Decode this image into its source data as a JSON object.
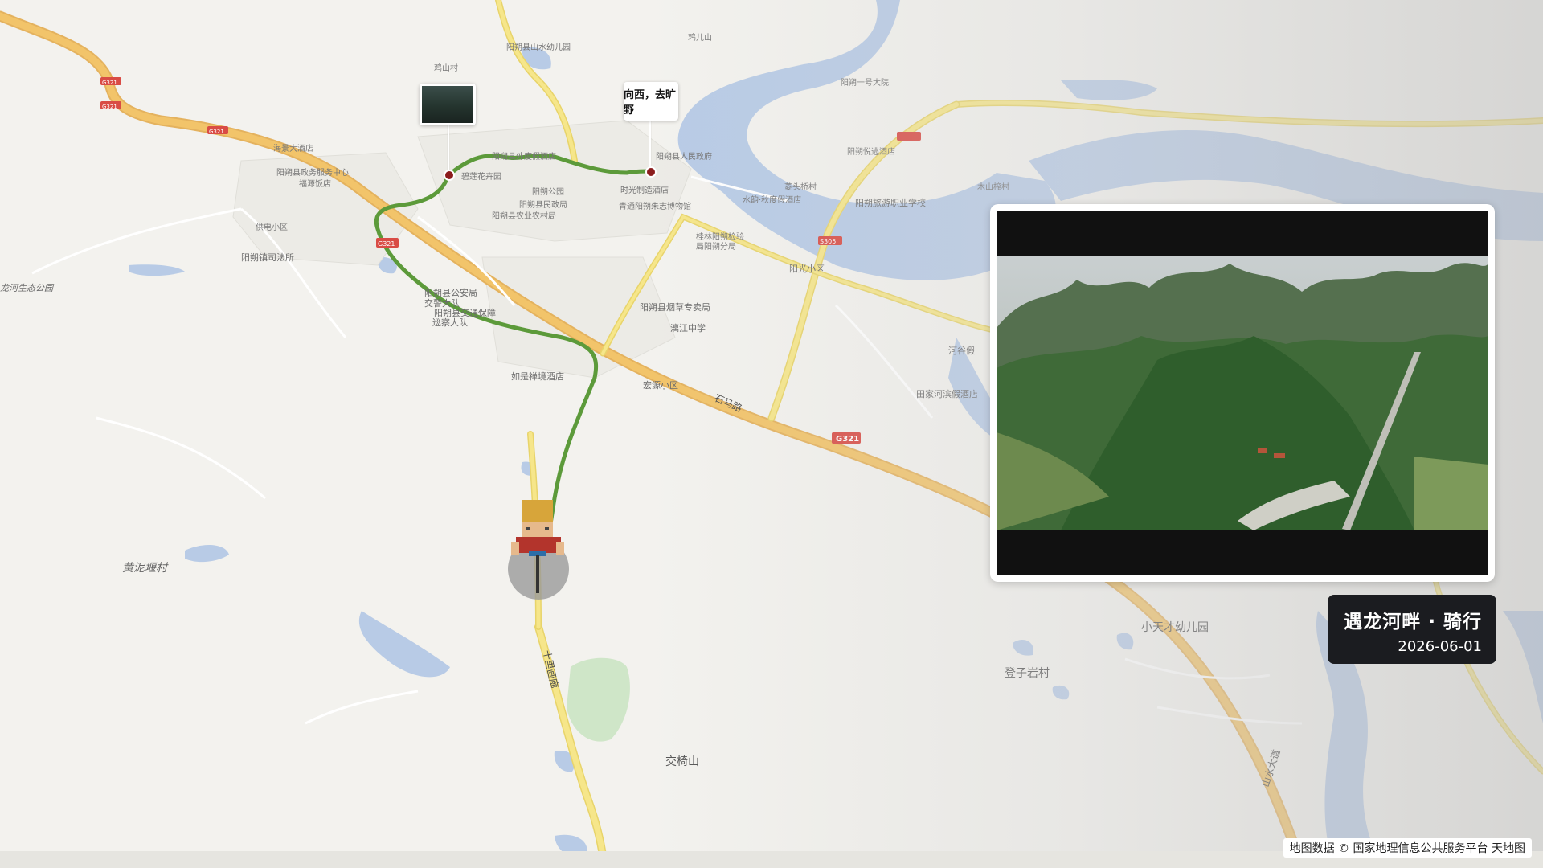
{
  "map": {
    "places": {
      "village1": "黄泥堰村",
      "mountain": "交椅山",
      "village2": "登子岩村",
      "kindergarten": "小天才幼儿园",
      "park": "龙河生态公园",
      "school1": "漓江中学",
      "hotel1": "如是禅境酒店",
      "resid1": "宏源小区",
      "resid2": "阳光小区",
      "hotel2": "田家河滨假酒店",
      "hotel3": "河谷假",
      "vschool": "阳朔旅游职业学校",
      "police": "阳朔县公安局",
      "police2": "交警大队",
      "police3": "阳朔县交通保障",
      "police4": "巡察大队",
      "court": "阳朔镇司法所",
      "tobacco": "阳朔县烟草专卖局",
      "gov": "阳朔县人民政府",
      "gov2": "阳朔县民政局",
      "gov3": "阳朔县农业农村局",
      "park2": "阳朔公园",
      "park3": "碧莲花卉园",
      "hotel4": "时光制造酒店",
      "museum": "青通阳朔朱志博物馆",
      "bank": "桂林阳朔检验",
      "bank2": "局阳朔分局",
      "service": "阳朔县政务服务中心",
      "hotel5": "海景大酒店",
      "hotel6": "福源饭店",
      "resid3": "供电小区",
      "kinder2": "阳朔县山水幼儿园",
      "hotel7": "阳朔一号大院",
      "hotel8": "阳朔悦逃酒店",
      "village3": "菱头桥村",
      "hotel9": "水韵·秋度假酒店",
      "village4": "木山榨村",
      "village5": "鸡山村",
      "village6": "鸡儿山",
      "hotel10": "阳朔县外度假酒店"
    },
    "roads": {
      "shima": "石马路",
      "shili": "十里画廊",
      "shanshui": "山水大道",
      "g321": "G321",
      "g321b": "G321",
      "s305": "S305",
      "g321c": "G321",
      "g321d": "G321",
      "g321e": "G321"
    }
  },
  "markers": {
    "label_text": "向西，去旷野"
  },
  "video": {
    "title": "遇龙河畔 · 骑行",
    "date": "2026-06-01"
  },
  "attribution": "地图数据 © 国家地理信息公共服务平台 天地图",
  "colors": {
    "route": "#5c9a3a",
    "highway": "#f2c46a",
    "yellow_road": "#f4e27a",
    "water": "#b8cbe6",
    "pin": "#8c1d1d"
  }
}
